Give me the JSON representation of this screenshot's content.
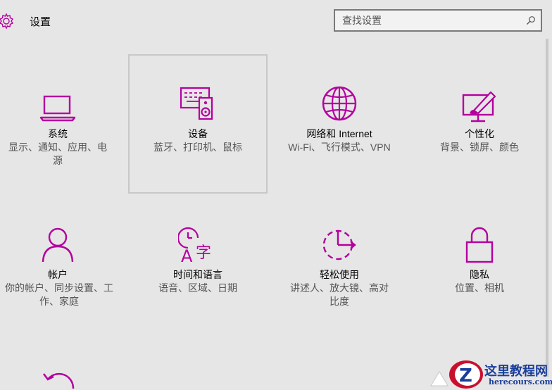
{
  "header": {
    "title": "设置",
    "icon": "gear-icon"
  },
  "search": {
    "placeholder": "查找设置",
    "icon": "search-icon"
  },
  "accent": "#b4009e",
  "tiles": [
    {
      "name": "系统",
      "desc": "显示、通知、应用、电源",
      "icon": "laptop-icon"
    },
    {
      "name": "设备",
      "desc": "蓝牙、打印机、鼠标",
      "icon": "keyboard-speaker-icon"
    },
    {
      "name": "网络和 Internet",
      "desc": "Wi-Fi、飞行模式、VPN",
      "icon": "globe-icon"
    },
    {
      "name": "个性化",
      "desc": "背景、锁屏、颜色",
      "icon": "paint-screen-icon"
    },
    {
      "name": "帐户",
      "desc": "你的帐户、同步设置、工作、家庭",
      "icon": "person-icon"
    },
    {
      "name": "时间和语言",
      "desc": "语音、区域、日期",
      "icon": "clock-language-icon"
    },
    {
      "name": "轻松使用",
      "desc": "讲述人、放大镜、高对比度",
      "icon": "ease-of-access-icon"
    },
    {
      "name": "隐私",
      "desc": "位置、相机",
      "icon": "lock-icon"
    },
    {
      "name": "",
      "desc": "",
      "icon": "update-icon"
    }
  ],
  "watermark": {
    "title": "这里教程网",
    "url": "herecours.com"
  }
}
